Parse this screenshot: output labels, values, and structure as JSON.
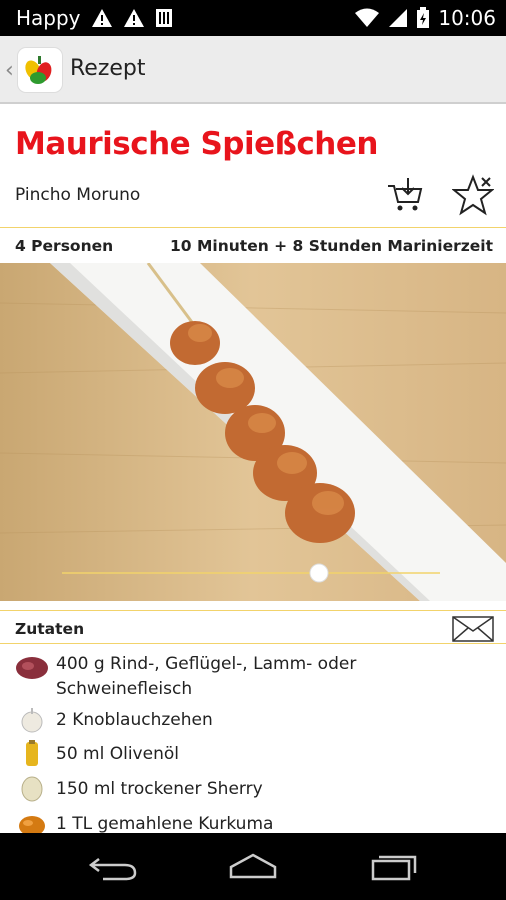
{
  "status_bar": {
    "carrier": "Happy",
    "time": "10:06",
    "icons": [
      "warning-icon",
      "warning-icon",
      "sim-icon",
      "wifi-icon",
      "signal-icon",
      "battery-icon"
    ]
  },
  "action_bar": {
    "title": "Rezept",
    "app_icon": "recipe-app-logo"
  },
  "recipe": {
    "title": "Maurische Spießchen",
    "subtitle": "Pincho Moruno",
    "persons": "4 Personen",
    "time": "10 Minuten + 8 Stunden Marinierzeit"
  },
  "ingredients_section": {
    "label": "Zutaten",
    "items": [
      {
        "text": "400 g Rind-, Geflügel-, Lamm- oder Schweinefleisch",
        "icon": "meat-icon"
      },
      {
        "text": "2  Knoblauchzehen",
        "icon": "garlic-icon"
      },
      {
        "text": "50 ml Olivenöl",
        "icon": "oil-icon"
      },
      {
        "text": "150 ml trockener Sherry",
        "icon": "sherry-icon"
      },
      {
        "text": "1 TL gemahlene Kurkuma",
        "icon": "spice-icon"
      }
    ]
  },
  "colors": {
    "accent": "#e8141c",
    "divider": "#f2d36b",
    "action_bar_bg": "#ececec"
  }
}
